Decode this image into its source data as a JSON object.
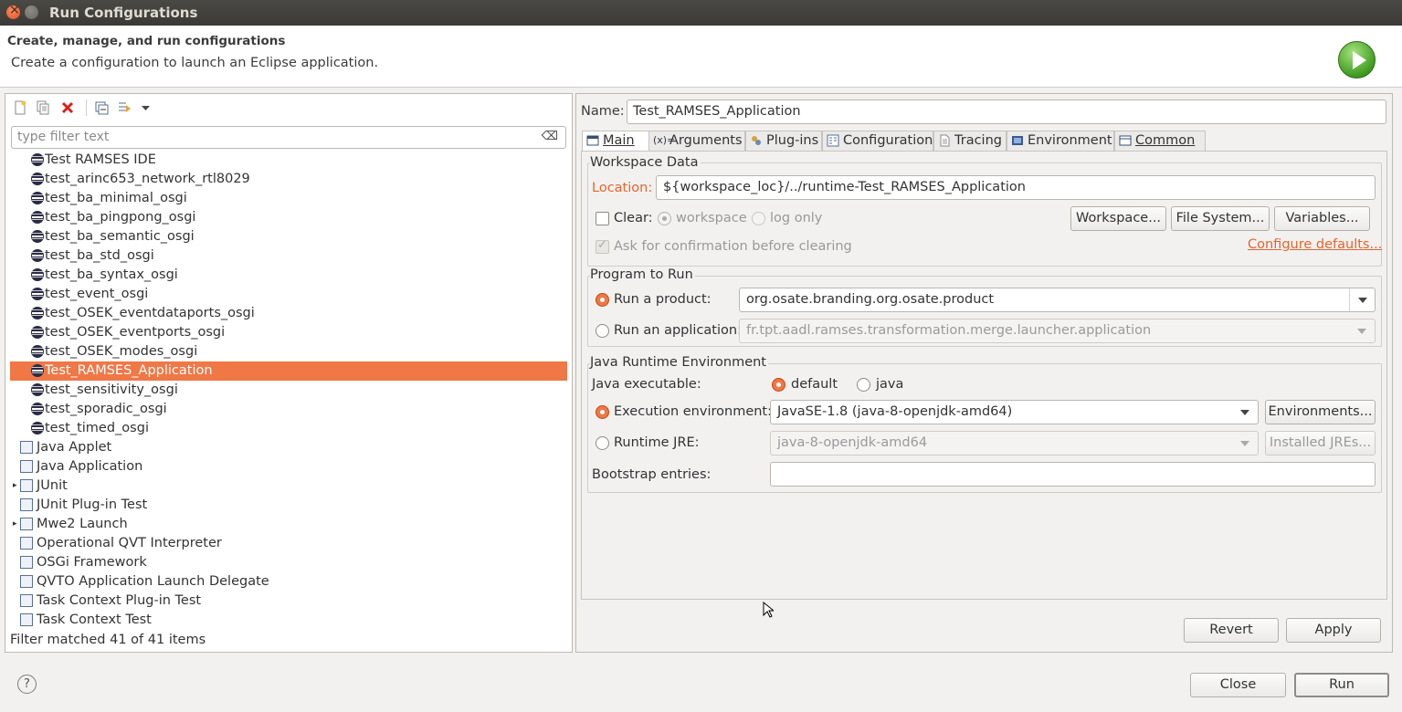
{
  "window": {
    "title": "Run Configurations"
  },
  "header": {
    "title": "Create, manage, and run configurations",
    "subtitle": "Create a configuration to launch an Eclipse application.",
    "run_icon": "run-launch-icon"
  },
  "left": {
    "toolbar": {
      "icons": [
        "new-configuration-icon",
        "duplicate-icon",
        "delete-icon",
        "collapse-all-icon",
        "filter-icon",
        "dropdown-arrow-icon"
      ]
    },
    "filter": {
      "placeholder": "type filter text",
      "value": ""
    },
    "tree": {
      "items": [
        {
          "label": "Test RAMSES IDE",
          "icon": "osgi-icon",
          "indent": 1
        },
        {
          "label": "test_arinc653_network_rtl8029",
          "icon": "osgi-icon",
          "indent": 1
        },
        {
          "label": "test_ba_minimal_osgi",
          "icon": "osgi-icon",
          "indent": 1
        },
        {
          "label": "test_ba_pingpong_osgi",
          "icon": "osgi-icon",
          "indent": 1
        },
        {
          "label": "test_ba_semantic_osgi",
          "icon": "osgi-icon",
          "indent": 1
        },
        {
          "label": "test_ba_std_osgi",
          "icon": "osgi-icon",
          "indent": 1
        },
        {
          "label": "test_ba_syntax_osgi",
          "icon": "osgi-icon",
          "indent": 1
        },
        {
          "label": "test_event_osgi",
          "icon": "osgi-icon",
          "indent": 1
        },
        {
          "label": "test_OSEK_eventdataports_osgi",
          "icon": "osgi-icon",
          "indent": 1
        },
        {
          "label": "test_OSEK_eventports_osgi",
          "icon": "osgi-icon",
          "indent": 1
        },
        {
          "label": "test_OSEK_modes_osgi",
          "icon": "osgi-icon",
          "indent": 1
        },
        {
          "label": "Test_RAMSES_Application",
          "icon": "osgi-icon",
          "indent": 1,
          "selected": true
        },
        {
          "label": "test_sensitivity_osgi",
          "icon": "osgi-icon",
          "indent": 1
        },
        {
          "label": "test_sporadic_osgi",
          "icon": "osgi-icon",
          "indent": 1
        },
        {
          "label": "test_timed_osgi",
          "icon": "osgi-icon",
          "indent": 1
        },
        {
          "label": "Java Applet",
          "icon": "java-applet-icon",
          "indent": 0
        },
        {
          "label": "Java Application",
          "icon": "java-application-icon",
          "indent": 0
        },
        {
          "label": "JUnit",
          "icon": "junit-icon",
          "indent": 0,
          "expandable": true
        },
        {
          "label": "JUnit Plug-in Test",
          "icon": "junit-plugin-icon",
          "indent": 0
        },
        {
          "label": "Mwe2 Launch",
          "icon": "mwe2-icon",
          "indent": 0,
          "expandable": true
        },
        {
          "label": "Operational QVT Interpreter",
          "icon": "qvt-icon",
          "indent": 0
        },
        {
          "label": "OSGi Framework",
          "icon": "osgi-framework-icon",
          "indent": 0
        },
        {
          "label": "QVTO Application Launch Delegate",
          "icon": "qvto-icon",
          "indent": 0
        },
        {
          "label": "Task Context Plug-in Test",
          "icon": "task-context-plugin-icon",
          "indent": 0
        },
        {
          "label": "Task Context Test",
          "icon": "task-context-icon",
          "indent": 0
        }
      ]
    },
    "status": "Filter matched 41 of 41 items"
  },
  "right": {
    "name_label": "Name:",
    "name_value": "Test_RAMSES_Application",
    "tabs": [
      {
        "label": "Main",
        "icon": "main-tab-icon",
        "active": true
      },
      {
        "label": "Arguments",
        "icon": "arguments-icon"
      },
      {
        "label": "Plug-ins",
        "icon": "plugins-icon"
      },
      {
        "label": "Configuration",
        "icon": "configuration-icon"
      },
      {
        "label": "Tracing",
        "icon": "tracing-icon"
      },
      {
        "label": "Environment",
        "icon": "environment-icon"
      },
      {
        "label": "Common",
        "icon": "common-icon"
      }
    ],
    "workspace": {
      "group_title": "Workspace Data",
      "location_label": "Location:",
      "location_value": "${workspace_loc}/../runtime-Test_RAMSES_Application",
      "clear_label": "Clear:",
      "clear_checked": false,
      "workspace_radio": "workspace",
      "log_only_radio": "log only",
      "workspace_button": "Workspace...",
      "file_system_button": "File System...",
      "variables_button": "Variables...",
      "ask_confirmation": "Ask for confirmation before clearing",
      "configure_defaults": "Configure defaults..."
    },
    "program": {
      "group_title": "Program to Run",
      "run_product_label": "Run a product:",
      "run_product_value": "org.osate.branding.org.osate.product",
      "run_application_label": "Run an application:",
      "run_application_value": "fr.tpt.aadl.ramses.transformation.merge.launcher.application",
      "selected": "product"
    },
    "jre": {
      "group_title": "Java Runtime Environment",
      "java_executable_label": "Java executable:",
      "default_radio": "default",
      "java_radio": "java",
      "execution_env_label": "Execution environment:",
      "execution_env_value": "JavaSE-1.8 (java-8-openjdk-amd64)",
      "environments_button": "Environments...",
      "runtime_jre_label": "Runtime JRE:",
      "runtime_jre_value": "java-8-openjdk-amd64",
      "installed_jres_button": "Installed JREs...",
      "bootstrap_label": "Bootstrap entries:",
      "bootstrap_value": ""
    },
    "revert_button": "Revert",
    "apply_button": "Apply"
  },
  "footer": {
    "help_icon": "help-icon",
    "close_button": "Close",
    "run_button": "Run"
  },
  "colors": {
    "selection": "#f07746",
    "accent_text": "#e4652c",
    "titlebar": "#3c3b37"
  }
}
